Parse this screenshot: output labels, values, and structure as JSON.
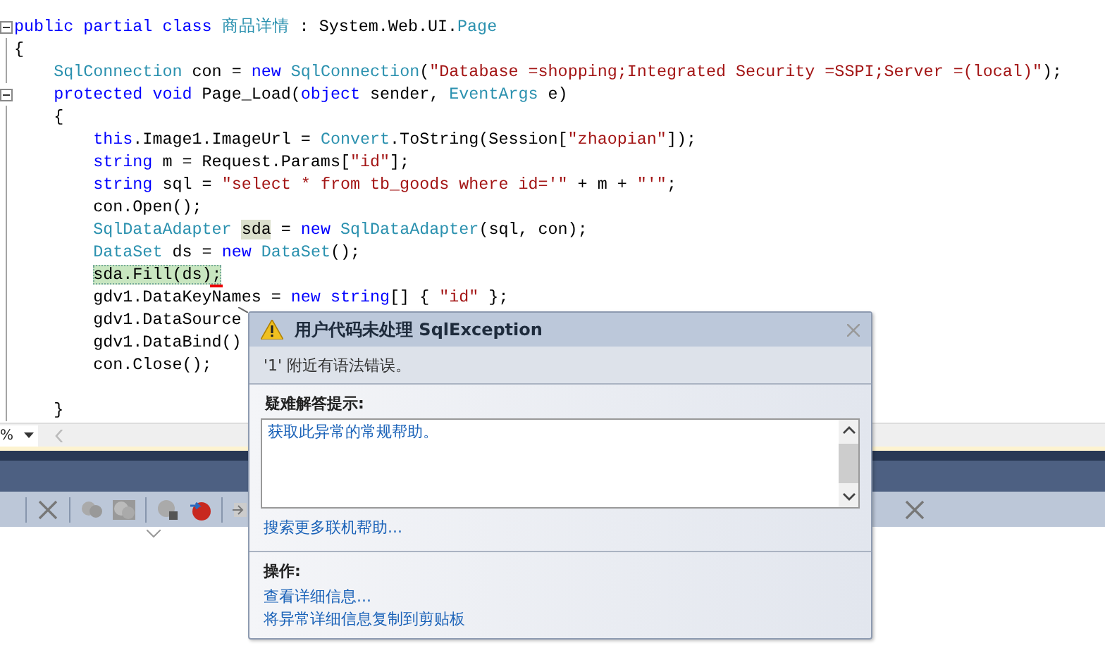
{
  "editor": {
    "lines": [
      {
        "fold": true,
        "current": false,
        "tokens": [
          {
            "kind": "keyword",
            "text": "public partial class "
          },
          {
            "kind": "type",
            "text": "商品详情"
          },
          {
            "kind": "plain",
            "text": " : System.Web.UI."
          },
          {
            "kind": "type",
            "text": "Page"
          }
        ]
      },
      {
        "fold": false,
        "current": false,
        "tokens": [
          {
            "kind": "plain",
            "text": "{"
          }
        ]
      },
      {
        "fold": false,
        "current": false,
        "tokens": [
          {
            "kind": "type",
            "text": "    SqlConnection"
          },
          {
            "kind": "plain",
            "text": " con = "
          },
          {
            "kind": "keyword",
            "text": "new "
          },
          {
            "kind": "type",
            "text": "SqlConnection"
          },
          {
            "kind": "plain",
            "text": "("
          },
          {
            "kind": "string",
            "text": "\"Database =shopping;Integrated Security =SSPI;Server =(local)\""
          },
          {
            "kind": "plain",
            "text": ");"
          }
        ]
      },
      {
        "fold": true,
        "current": false,
        "tokens": [
          {
            "kind": "keyword",
            "text": "    protected void "
          },
          {
            "kind": "plain",
            "text": "Page_Load("
          },
          {
            "kind": "keyword",
            "text": "object"
          },
          {
            "kind": "plain",
            "text": " sender, "
          },
          {
            "kind": "type",
            "text": "EventArgs"
          },
          {
            "kind": "plain",
            "text": " e)"
          }
        ]
      },
      {
        "fold": false,
        "current": false,
        "tokens": [
          {
            "kind": "plain",
            "text": "    {"
          }
        ]
      },
      {
        "fold": false,
        "current": false,
        "tokens": [
          {
            "kind": "keyword",
            "text": "        this"
          },
          {
            "kind": "plain",
            "text": ".Image1.ImageUrl = "
          },
          {
            "kind": "type",
            "text": "Convert"
          },
          {
            "kind": "plain",
            "text": ".ToString(Session["
          },
          {
            "kind": "string",
            "text": "\"zhaopian\""
          },
          {
            "kind": "plain",
            "text": "]);"
          }
        ]
      },
      {
        "fold": false,
        "current": false,
        "tokens": [
          {
            "kind": "keyword",
            "text": "        string"
          },
          {
            "kind": "plain",
            "text": " m = Request.Params["
          },
          {
            "kind": "string",
            "text": "\"id\""
          },
          {
            "kind": "plain",
            "text": "];"
          }
        ]
      },
      {
        "fold": false,
        "current": false,
        "tokens": [
          {
            "kind": "keyword",
            "text": "        string"
          },
          {
            "kind": "plain",
            "text": " sql = "
          },
          {
            "kind": "string",
            "text": "\"select * from tb_goods where id='\""
          },
          {
            "kind": "plain",
            "text": " + m + "
          },
          {
            "kind": "string",
            "text": "\"'\""
          },
          {
            "kind": "plain",
            "text": ";"
          }
        ]
      },
      {
        "fold": false,
        "current": false,
        "tokens": [
          {
            "kind": "plain",
            "text": "        con.Open();"
          }
        ]
      },
      {
        "fold": false,
        "current": false,
        "tokens": [
          {
            "kind": "type",
            "text": "        SqlDataAdapter "
          },
          {
            "kind": "reference",
            "text": "sda"
          },
          {
            "kind": "plain",
            "text": " = "
          },
          {
            "kind": "keyword",
            "text": "new "
          },
          {
            "kind": "type",
            "text": "SqlDataAdapter"
          },
          {
            "kind": "plain",
            "text": "(sql, con);"
          }
        ]
      },
      {
        "fold": false,
        "current": false,
        "tokens": [
          {
            "kind": "type",
            "text": "        DataSet"
          },
          {
            "kind": "plain",
            "text": " ds = "
          },
          {
            "kind": "keyword",
            "text": "new "
          },
          {
            "kind": "type",
            "text": "DataSet"
          },
          {
            "kind": "plain",
            "text": "();"
          }
        ]
      },
      {
        "fold": false,
        "current": true,
        "tokens": [
          {
            "kind": "plain",
            "text": "        sda.Fill(ds);"
          }
        ]
      },
      {
        "fold": false,
        "current": false,
        "tokens": [
          {
            "kind": "plain",
            "text": "        gdv1.DataKeyNames = "
          },
          {
            "kind": "keyword",
            "text": "new string"
          },
          {
            "kind": "plain",
            "text": "[] { "
          },
          {
            "kind": "string",
            "text": "\"id\""
          },
          {
            "kind": "plain",
            "text": " };"
          }
        ]
      },
      {
        "fold": false,
        "current": false,
        "tokens": [
          {
            "kind": "plain",
            "text": "        gdv1.DataSource"
          }
        ]
      },
      {
        "fold": false,
        "current": false,
        "tokens": [
          {
            "kind": "plain",
            "text": "        gdv1.DataBind()"
          }
        ]
      },
      {
        "fold": false,
        "current": false,
        "tokens": [
          {
            "kind": "plain",
            "text": "        con.Close();"
          }
        ]
      },
      {
        "fold": false,
        "current": false
      },
      {
        "fold": false,
        "current": false,
        "tokens": [
          {
            "kind": "plain",
            "text": "    }"
          }
        ]
      }
    ]
  },
  "zoom_combo": {
    "value": "%"
  },
  "exception_popup": {
    "title": "用户代码未处理 SqlException",
    "message": "'1' 附近有语法错误。",
    "tips_heading": "疑难解答提示:",
    "tips": [
      "获取此异常的常规帮助。"
    ],
    "search_link": "搜索更多联机帮助...",
    "actions_heading": "操作:",
    "actions": [
      "查看详细信息...",
      "将异常详细信息复制到剪贴板"
    ]
  }
}
